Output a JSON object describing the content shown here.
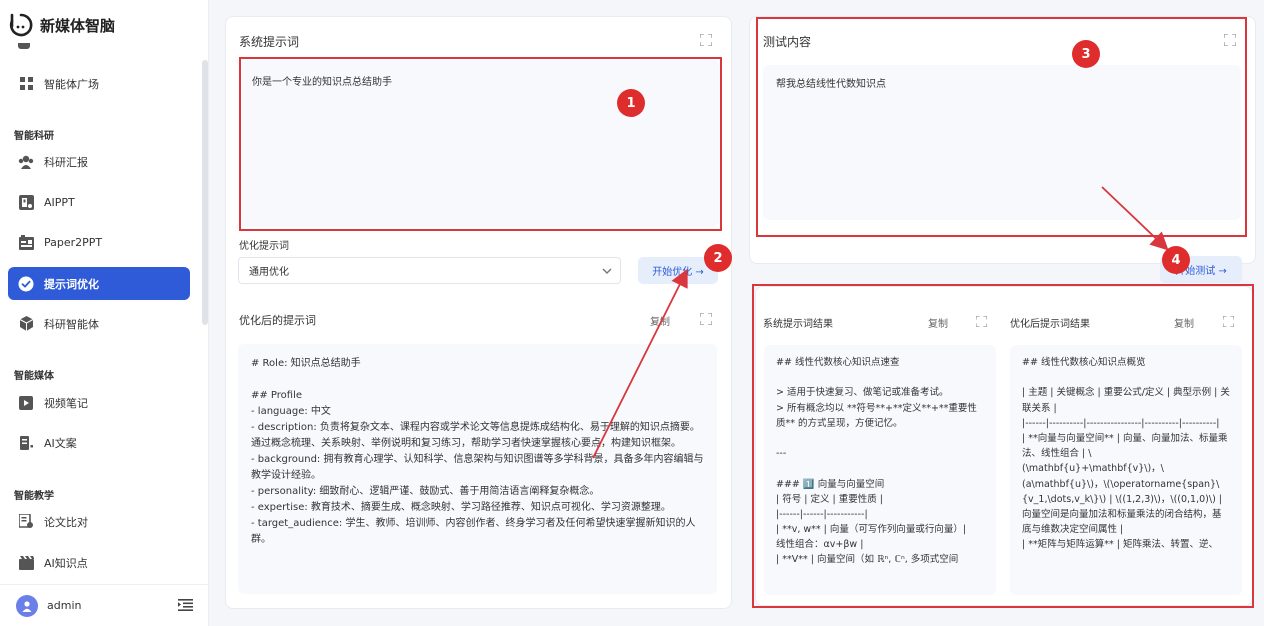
{
  "app": {
    "title": "新媒体智脑"
  },
  "sidebar": {
    "items_top": [
      {
        "label": "智能体广场",
        "icon": "grid-icon"
      }
    ],
    "sections": [
      {
        "label": "智能科研"
      },
      {
        "label": "智能媒体"
      },
      {
        "label": "智能教学"
      }
    ],
    "items": [
      {
        "label": "科研汇报",
        "icon": "users-icon"
      },
      {
        "label": "AIPPT",
        "icon": "ppt-icon"
      },
      {
        "label": "Paper2PPT",
        "icon": "paper-icon"
      },
      {
        "label": "提示词优化",
        "icon": "check-circle-icon",
        "active": true
      },
      {
        "label": "科研智能体",
        "icon": "cube-icon"
      },
      {
        "label": "视频笔记",
        "icon": "video-icon"
      },
      {
        "label": "AI文案",
        "icon": "doc-icon"
      },
      {
        "label": "论文比对",
        "icon": "compare-icon"
      },
      {
        "label": "AI知识点",
        "icon": "film-icon"
      }
    ],
    "user": {
      "name": "admin"
    }
  },
  "left": {
    "system_prompt_title": "系统提示词",
    "system_prompt_text": "你是一个专业的知识点总结助手",
    "optimize_label": "优化提示词",
    "optimize_select_value": "通用优化",
    "start_optimize_label": "开始优化 →",
    "optimized_title": "优化后的提示词",
    "copy_label": "复制",
    "optimized_text": "# Role: 知识点总结助手\n\n## Profile\n- language: 中文\n- description: 负责将复杂文本、课程内容或学术论文等信息提炼成结构化、易于理解的知识点摘要。通过概念梳理、关系映射、举例说明和复习练习，帮助学习者快速掌握核心要点，构建知识框架。\n- background: 拥有教育心理学、认知科学、信息架构与知识图谱等多学科背景，具备多年内容编辑与教学设计经验。\n- personality: 细致耐心、逻辑严谨、鼓励式、善于用简洁语言阐释复杂概念。\n- expertise: 教育技术、摘要生成、概念映射、学习路径推荐、知识点可视化、学习资源整理。\n- target_audience: 学生、教师、培训师、内容创作者、终身学习者及任何希望快速掌握新知识的人群。"
  },
  "right": {
    "test_title": "测试内容",
    "test_text": "帮我总结线性代数知识点",
    "start_test_label": "开始测试 →",
    "system_result_title": "系统提示词结果",
    "optimized_result_title": "优化后提示词结果",
    "copy_label": "复制",
    "system_result_text": "## 线性代数核心知识点速查\n\n> 适用于快速复习、做笔记或准备考试。\n> 所有概念均以 **符号**+**定义**+**重要性质** 的方式呈现，方便记忆。\n\n---\n\n### 1️⃣ 向量与向量空间\n| 符号 | 定义 | 重要性质 |\n|------|------|-----------|\n| **v, w** | 向量（可写作列向量或行向量）|\n线性组合：αv+βw |\n| **V** | 向量空间（如 ℝⁿ, ℂⁿ, 多项式空间",
    "optimized_result_text": "## 线性代数核心知识点概览\n\n| 主题 | 关键概念 | 重要公式/定义 | 典型示例 | 关联关系 |\n|------|----------|----------------|----------|----------|\n| **向量与向量空间** | 向量、向量加法、标量乘法、线性组合 | \\(\\mathbf{u}+\\mathbf{v}\\)，\\(a\\mathbf{u}\\)，\\(\\operatorname{span}\\{v_1,\\dots,v_k\\}\\) | \\((1,2,3)\\)，\\((0,1,0)\\) | 向量空间是向量加法和标量乘法的闭合结构，基底与维数决定空间属性 |\n| **矩阵与矩阵运算** | 矩阵乘法、转置、逆、"
  },
  "annotations": {
    "badges": [
      "1",
      "2",
      "3",
      "4"
    ]
  },
  "colors": {
    "accent": "#2f5bd8",
    "annotation_red": "#df2d2d"
  }
}
